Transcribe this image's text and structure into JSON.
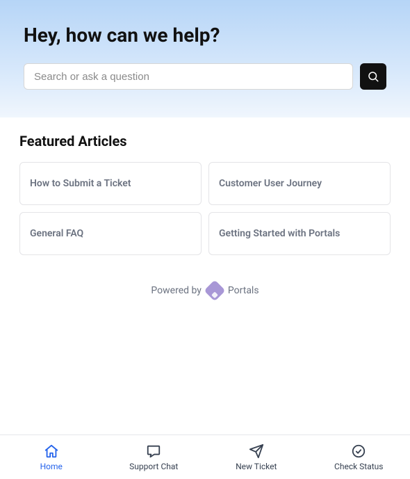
{
  "hero": {
    "title": "Hey, how can we help?",
    "search_placeholder": "Search or ask a question"
  },
  "featured": {
    "heading": "Featured Articles",
    "articles": [
      "How to Submit a Ticket",
      "Customer User Journey",
      "General FAQ",
      "Getting Started with Portals"
    ]
  },
  "powered": {
    "prefix": "Powered by",
    "brand": "Portals"
  },
  "tabs": {
    "home": "Home",
    "chat": "Support Chat",
    "new_ticket": "New Ticket",
    "check_status": "Check Status"
  }
}
